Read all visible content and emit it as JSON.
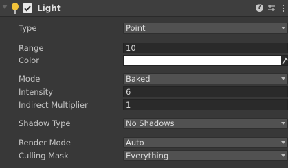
{
  "component": {
    "title": "Light",
    "enabled": true
  },
  "icons": {
    "foldout": "foldout-triangle-icon",
    "light": "light-bulb-icon",
    "help": "help-icon",
    "presets": "presets-icon",
    "menu": "context-menu-icon",
    "eyedropper": "eyedropper-icon"
  },
  "properties": {
    "type": {
      "label": "Type",
      "value": "Point"
    },
    "range": {
      "label": "Range",
      "value": "10"
    },
    "color": {
      "label": "Color",
      "value": "#FFFFFF"
    },
    "mode": {
      "label": "Mode",
      "value": "Baked"
    },
    "intensity": {
      "label": "Intensity",
      "value": "6"
    },
    "indirect_multiplier": {
      "label": "Indirect Multiplier",
      "value": "1"
    },
    "shadow_type": {
      "label": "Shadow Type",
      "value": "No Shadows"
    },
    "render_mode": {
      "label": "Render Mode",
      "value": "Auto"
    },
    "culling_mask": {
      "label": "Culling Mask",
      "value": "Everything"
    }
  },
  "colors": {
    "panel_bg": "#383838",
    "header_bg": "#3e3e3e",
    "field_bg": "#2a2a2a",
    "dropdown_bg": "#515151",
    "bulb": "#f2c33a"
  }
}
